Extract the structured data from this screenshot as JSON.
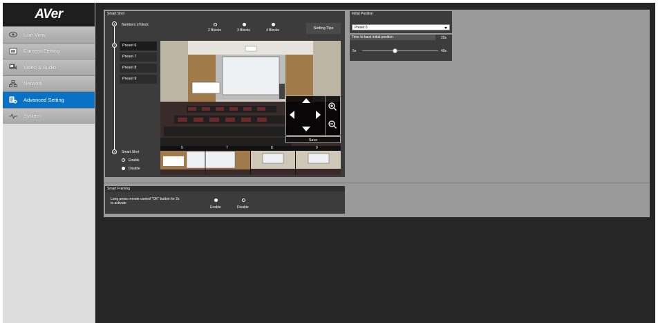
{
  "logo": "AVer",
  "sidebar": {
    "items": [
      {
        "label": "Live View",
        "icon": "eye-icon"
      },
      {
        "label": "Camera Setting",
        "icon": "camera-setting-icon"
      },
      {
        "label": "Video & Audio",
        "icon": "video-audio-icon"
      },
      {
        "label": "Network",
        "icon": "network-icon"
      },
      {
        "label": "Advanced Setting",
        "icon": "advanced-setting-icon"
      },
      {
        "label": "System",
        "icon": "system-icon"
      }
    ],
    "active_index": 4
  },
  "smart_shot": {
    "title": "Smart Shot",
    "step1_label": "Numbers of block",
    "blocks": [
      "2 Blocks",
      "3 Blocks",
      "4 Blocks"
    ],
    "selected_block": "2 Blocks",
    "setting_tips": "Setting Tips",
    "presets": [
      "Preset 6",
      "Preset 7",
      "Preset 8",
      "Preset 9"
    ],
    "selected_preset": "Preset 6",
    "save": "Save",
    "thumb_labels": [
      "6",
      "7",
      "8",
      "9"
    ],
    "step3_label": "Smart Shot",
    "enable": "Enable",
    "disable": "Disable",
    "smart_shot_selected": "Disable",
    "steps": [
      "1",
      "2",
      "3"
    ]
  },
  "initial_position": {
    "title": "Initial Position",
    "preset_value": "Preset 6",
    "time_label": "Time to back initial position",
    "time_value": "20s",
    "min": "5s",
    "max": "40s",
    "slider_fraction": 0.43
  },
  "smart_framing": {
    "title": "Smart Framing",
    "text_line1": "Long press remote control \"OK\" button for 2s",
    "text_line2": "to activate",
    "enable": "Enable",
    "disable": "Disable",
    "selected": "Enable"
  },
  "colors": {
    "accent": "#0a72c4",
    "panel": "#3c3c3c",
    "background": "#262626"
  }
}
